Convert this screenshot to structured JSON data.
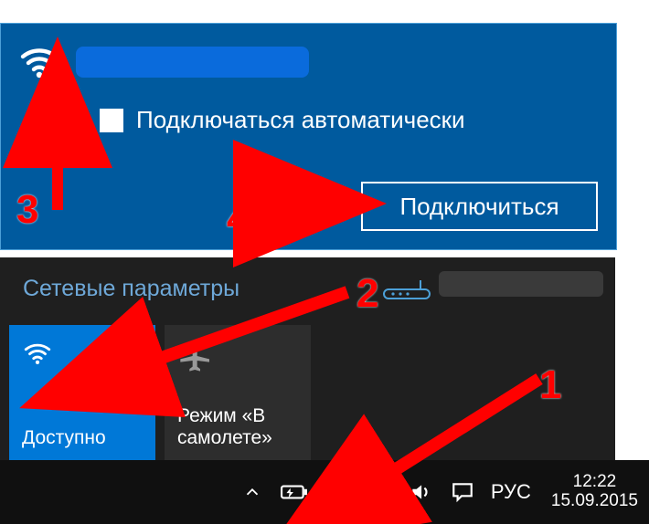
{
  "selected_network": {
    "auto_connect_label": "Подключаться автоматически",
    "connect_button": "Подключиться"
  },
  "settings": {
    "title": "Сетевые параметры",
    "wifi_tile": "Доступно",
    "airplane_tile": "Режим «В самолете»"
  },
  "taskbar": {
    "language": "РУС",
    "time": "12:22",
    "date": "15.09.2015"
  },
  "annotations": {
    "n1": "1",
    "n2": "2",
    "n3": "3",
    "n4": "4"
  }
}
